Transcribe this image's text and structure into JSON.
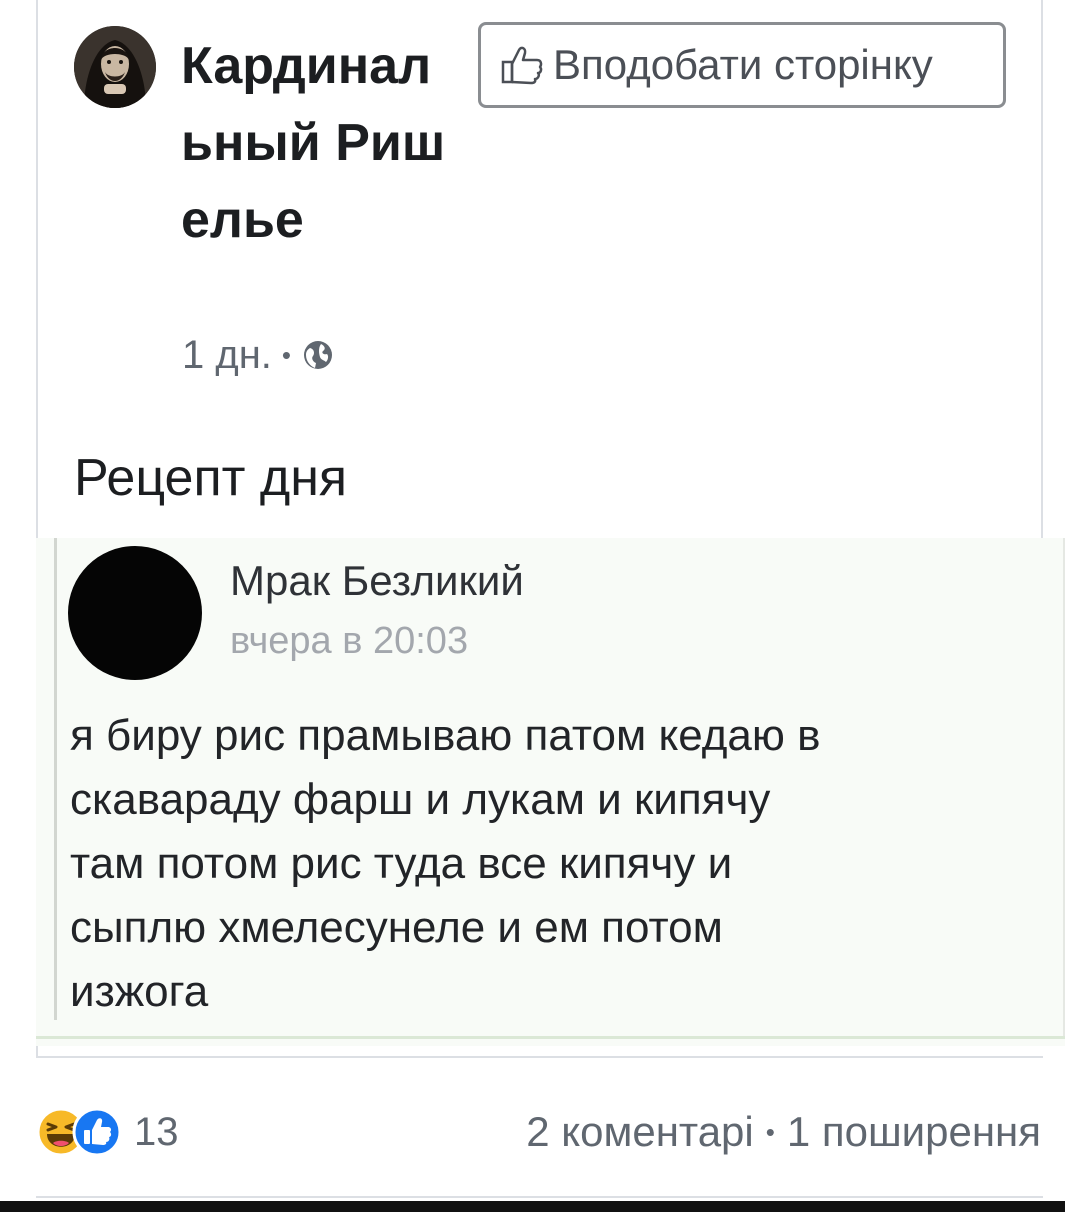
{
  "post": {
    "page_name": "Кардинальный Ришелье",
    "like_page_button": "Вподобати сторінку",
    "time": "1 дн.",
    "separator": "•",
    "privacy_icon": "globe-icon",
    "text": "Рецепт дня"
  },
  "embedded_comment": {
    "author": "Мрак Безликий",
    "time": "вчера в 20:03",
    "lines": [
      "я биру рис прамываю патом кедаю в",
      "скавараду фарш и лукам и кипячу",
      "там потом рис туда все кипячу и",
      "сыплю хмелесунеле и ем потом",
      "изжога"
    ]
  },
  "footer": {
    "reaction_icons": [
      "haha-reaction-icon",
      "like-reaction-icon"
    ],
    "reaction_count": "13",
    "comments": "2 коментарі",
    "separator": "•",
    "shares": "1 поширення"
  },
  "colors": {
    "text": "#1c1e21",
    "secondary_text": "#606770",
    "border": "#dcdfe4",
    "like_blue": "#1877f2",
    "haha_yellow": "#f7b928"
  }
}
